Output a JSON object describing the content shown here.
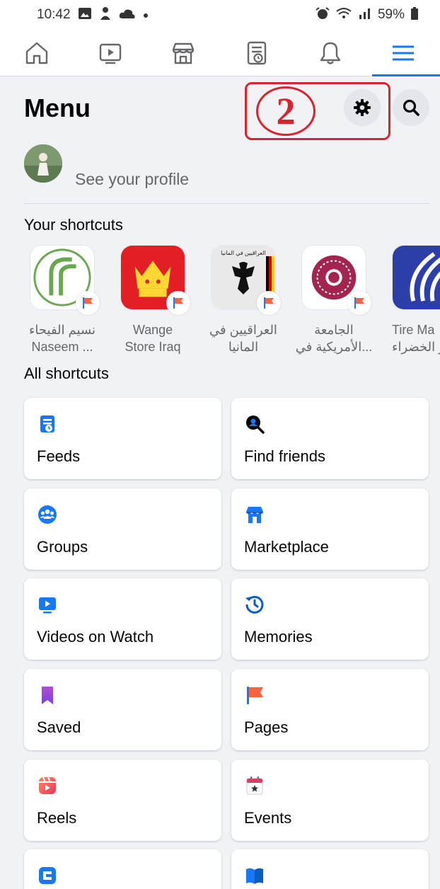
{
  "status_bar": {
    "time": "10:42",
    "left_icons": [
      "gallery-icon",
      "person-icon",
      "cloud-icon",
      "dot-icon"
    ],
    "right_icons": [
      "alarm-icon",
      "wifi-icon",
      "signal-icon"
    ],
    "battery": "59%"
  },
  "nav": {
    "tabs": [
      {
        "name": "home",
        "icon": "home-icon"
      },
      {
        "name": "watch",
        "icon": "video-icon"
      },
      {
        "name": "marketplace",
        "icon": "shop-icon"
      },
      {
        "name": "feeds",
        "icon": "feeds-icon"
      },
      {
        "name": "notifications",
        "icon": "bell-icon"
      },
      {
        "name": "menu",
        "icon": "hamburger-icon",
        "active": true
      }
    ],
    "active_color": "#1877f2"
  },
  "header": {
    "title": "Menu",
    "annotation_number": "2"
  },
  "profile": {
    "label": "See your profile"
  },
  "shortcuts": {
    "title": "Your shortcuts",
    "items": [
      {
        "line1": "نسيم الفيحاء",
        "line2": "Naseem ..."
      },
      {
        "line1": "Wange",
        "line2": "Store Iraq"
      },
      {
        "line1": "العراقيين في",
        "line2": "المانيا",
        "thumb_text": "العراقيين في المانيا"
      },
      {
        "line1": "الجامعة",
        "line2": "الأمريكية في..."
      },
      {
        "line1": "Tire Ma",
        "line2": "ار الخضراء"
      }
    ]
  },
  "all_shortcuts": {
    "title": "All shortcuts",
    "items": [
      {
        "label": "Feeds",
        "icon": "feeds-icon"
      },
      {
        "label": "Find friends",
        "icon": "find-friends-icon"
      },
      {
        "label": "Groups",
        "icon": "groups-icon"
      },
      {
        "label": "Marketplace",
        "icon": "marketplace-icon"
      },
      {
        "label": "Videos on Watch",
        "icon": "watch-icon"
      },
      {
        "label": "Memories",
        "icon": "memories-icon"
      },
      {
        "label": "Saved",
        "icon": "saved-icon"
      },
      {
        "label": "Pages",
        "icon": "pages-icon"
      },
      {
        "label": "Reels",
        "icon": "reels-icon"
      },
      {
        "label": "Events",
        "icon": "events-icon"
      },
      {
        "label": "",
        "icon": "gaming-icon"
      },
      {
        "label": "",
        "icon": "news-icon"
      }
    ]
  },
  "colors": {
    "accent": "#1877f2",
    "annotation": "#d9232d",
    "background": "#f0f2f5"
  }
}
